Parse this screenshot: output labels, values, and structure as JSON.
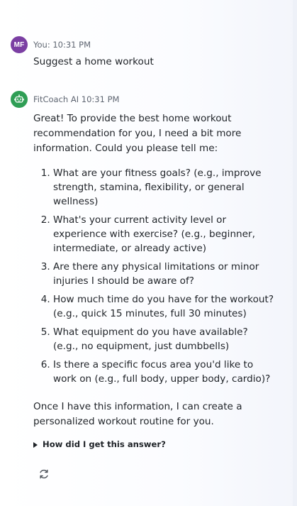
{
  "user_message": {
    "avatar_initials": "MF",
    "sender_line": "You: 10:31 PM",
    "text": "Suggest a home workout"
  },
  "ai_message": {
    "avatar_icon": "robot-icon",
    "sender_line": "FitCoach AI 10:31 PM",
    "intro": "Great! To provide the best home workout recommendation for you, I need a bit more information. Could you please tell me:",
    "questions": [
      "What are your fitness goals? (e.g., improve strength, stamina, flexibility, or general wellness)",
      "What's your current activity level or experience with exercise? (e.g., beginner, intermediate, or already active)",
      "Are there any physical limitations or minor injuries I should be aware of?",
      "How much time do you have for the workout? (e.g., quick 15 minutes, full 30 minutes)",
      "What equipment do you have available? (e.g., no equipment, just dumbbells)",
      "Is there a specific focus area you'd like to work on (e.g., full body, upper body, cardio)?"
    ],
    "outro": "Once I have this information, I can create a personalized workout routine for you.",
    "details_label": "How did I get this answer?"
  },
  "actions": {
    "regenerate_icon": "refresh-icon"
  },
  "colors": {
    "user_avatar": "#7b3fa3",
    "ai_avatar": "#2f9e55"
  }
}
